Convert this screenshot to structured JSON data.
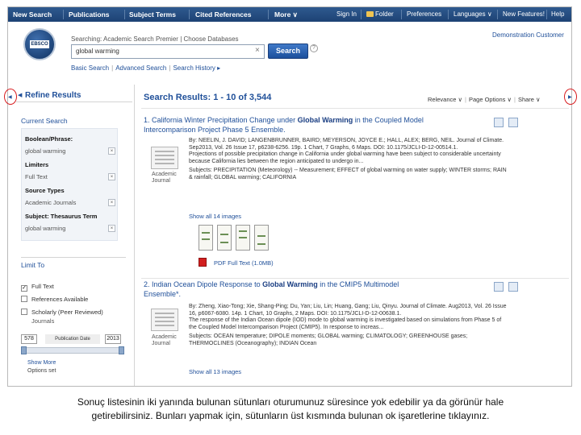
{
  "topnav": {
    "left_items": [
      "New Search",
      "Publications",
      "Subject Terms",
      "Cited References",
      "More ∨"
    ],
    "right_items": [
      "Sign In",
      "Folder",
      "Preferences",
      "Languages ∨",
      "New Features!",
      "Help"
    ]
  },
  "header": {
    "logo_text": "EBSCO",
    "searching_label": "Searching: Academic Search Premier",
    "choose_db": "Choose Databases",
    "query": "global warming",
    "search_button": "Search",
    "links": [
      "Basic Search",
      "Advanced Search",
      "Search History ▸"
    ],
    "customer": "Demonstration Customer"
  },
  "refine": {
    "title": "Refine Results",
    "current_search": "Current Search",
    "rows": [
      {
        "head": "Boolean/Phrase:",
        "value": "global warming"
      },
      {
        "head": "Limiters",
        "value": "Full Text"
      },
      {
        "head": "Source Types",
        "value": "Academic Journals"
      },
      {
        "head": "Subject: Thesaurus Term",
        "value": "global warming"
      }
    ],
    "limit_to": "Limit To",
    "options": [
      {
        "label": "Full Text",
        "checked": true
      },
      {
        "label": "References Available",
        "checked": false
      },
      {
        "label": "Scholarly (Peer Reviewed)",
        "checked": false
      }
    ],
    "scholarly_sub": "Journals",
    "date_from": "578",
    "date_label": "Publication Date",
    "date_to": "2013",
    "show_more": "Show More",
    "options_set": "Options set"
  },
  "results": {
    "heading": "Search Results: 1 - 10 of 3,544",
    "tools": [
      "Relevance ∨",
      "Page Options ∨",
      "Share ∨"
    ],
    "records": [
      {
        "title_line1_pre": "1. California Winter Precipitation Change under ",
        "title_bold": "Global Warming",
        "title_line1_post": " in the Coupled Model",
        "title_line2": "Intercomparison Project Phase 5 Ensemble.",
        "meta1": "By: NEELIN, J. DAVID; LANGENBRUNNER, BAIRD; MEYERSON, JOYCE E.; HALL, ALEX; BERG, NEIL. Journal of Climate.",
        "meta2": "Sep2013, Vol. 26 Issue 17, p6238-6256. 19p. 1 Chart, 7 Graphs, 6 Maps. DOI: 10.1175/JCLI-D-12-00514.1.",
        "abstract1": "Projections of possible precipitation change in California under global warming have been subject to considerable uncertainty",
        "abstract2": "because California lies between the region anticipated to undergo in...",
        "subjects1": "Subjects: PRECIPITATION (Meteorology) -- Measurement; EFFECT of global warming on water supply; WINTER storms; RAIN",
        "subjects2": "& rainfall; GLOBAL warming; CALIFORNIA",
        "doc_type": "Academic Journal",
        "images_link": "Show all 14 images",
        "fulltext": "PDF Full Text (1.0MB)"
      },
      {
        "title_line1_pre": "2. Indian Ocean Dipole Response to ",
        "title_bold": "Global Warming",
        "title_line1_post": " in the CMIP5 Multimodel",
        "title_line2": "Ensemble*.",
        "meta1": "By: Zheng, Xiao-Tong; Xie, Shang-Ping; Du, Yan; Liu, Lin; Huang, Gang; Liu, Qinyu. Journal of Climate. Aug2013, Vol. 26 Issue",
        "meta2": "16, p6067-6080. 14p. 1 Chart, 10 Graphs, 2 Maps. DOI: 10.1175/JCLI-D-12-00638.1.",
        "abstract1": "The response of the Indian Ocean dipole (IOD) mode to global warming is investigated based on simulations from Phase 5 of",
        "abstract2": "the Coupled Model Intercomparison Project (CMIP5). In response to increas...",
        "subjects1": "Subjects: OCEAN temperature; DIPOLE moments; GLOBAL warming; CLIMATOLOGY; GREENHOUSE gases;",
        "subjects2": "THERMOCLINES (Oceanography); INDIAN Ocean",
        "doc_type": "Academic Journal",
        "images_link": "Show all 13 images"
      }
    ]
  },
  "caption": {
    "line1": "Sonuç listesinin iki yanında bulunan sütunları oturumunuz süresince yok edebilir ya da görünür hale",
    "line2": "getirebilirsiniz. Bunları yapmak için, sütunların üst kısmında bulunan ok işaretlerine tıklayınız."
  },
  "colors": {
    "nav": "#1d4274",
    "link": "#1f4f99",
    "marker": "#d7191c"
  }
}
